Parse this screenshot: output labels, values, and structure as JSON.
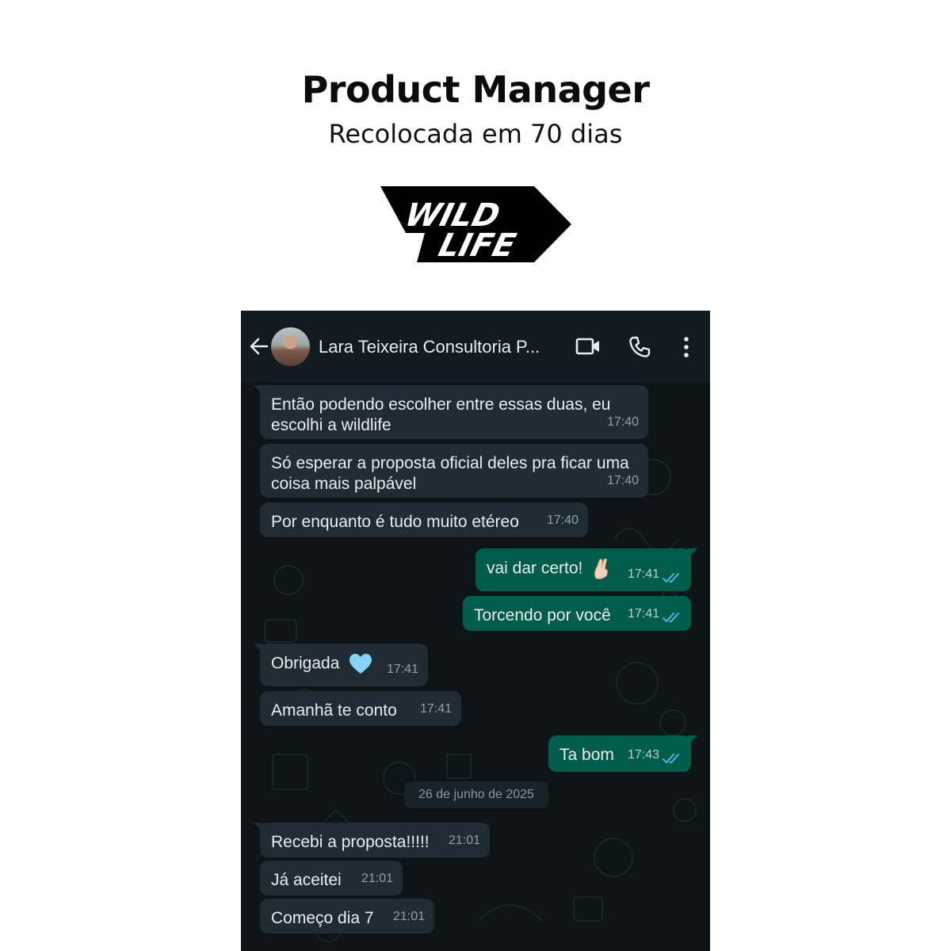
{
  "header": {
    "title": "Product Manager",
    "subtitle": "Recolocada em 70 dias"
  },
  "logo": {
    "line1": "WILD",
    "line2": "LIFE"
  },
  "appbar": {
    "contact_name": "Lara Teixeira Consultoria P...",
    "icons": [
      "back-arrow-icon",
      "avatar",
      "video-call-icon",
      "phone-icon",
      "more-vertical-icon"
    ],
    "background": "#111b21"
  },
  "chat": {
    "colors": {
      "incoming": "#1f2c33",
      "outgoing": "#005c4b",
      "read_ticks": "#53bdeb"
    },
    "messages": [
      {
        "direction": "in",
        "text": "Então podendo escolher entre essas duas, eu escolhi a wildlife",
        "time": "17:40"
      },
      {
        "direction": "in",
        "text": "Só esperar a proposta oficial deles pra ficar uma coisa mais palpável",
        "time": "17:40"
      },
      {
        "direction": "in",
        "text": "Por enquanto é tudo muito etéreo",
        "time": "17:40"
      },
      {
        "direction": "out",
        "text": "vai dar certo!",
        "emoji": "crossed-fingers-emoji",
        "time": "17:41",
        "status": "read"
      },
      {
        "direction": "out",
        "text": "Torcendo por você",
        "time": "17:41",
        "status": "read"
      },
      {
        "direction": "in",
        "text": "Obrigada",
        "emoji": "light-blue-heart-emoji",
        "time": "17:41"
      },
      {
        "direction": "in",
        "text": "Amanhã te conto",
        "time": "17:41"
      },
      {
        "direction": "out",
        "text": "Ta bom",
        "time": "17:43",
        "status": "read"
      },
      {
        "direction": "in",
        "text": "Recebi a proposta!!!!!",
        "time": "21:01"
      },
      {
        "direction": "in",
        "text": "Já aceitei",
        "time": "21:01"
      },
      {
        "direction": "in",
        "text": "Começo dia 7",
        "time": "21:01"
      }
    ],
    "date_separator": "26 de junho de 2025"
  }
}
